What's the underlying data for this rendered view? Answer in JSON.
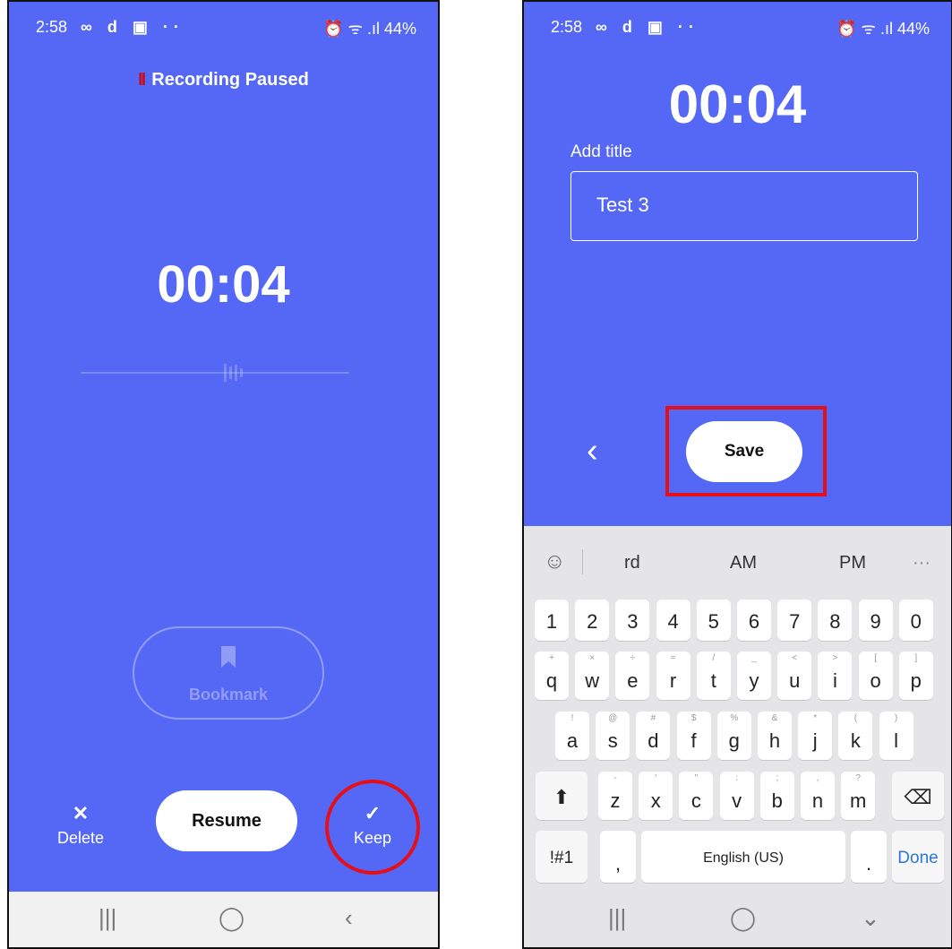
{
  "left": {
    "status": {
      "time": "2:58",
      "notif": "∞ d ▣ ··",
      "right": "⏰ ᯤ .ıl 44%"
    },
    "paused_icon": "II",
    "paused_label": "Recording Paused",
    "timer": "00:04",
    "bookmark_label": "Bookmark",
    "delete_icon": "✕",
    "delete_label": "Delete",
    "resume_label": "Resume",
    "keep_icon": "✓",
    "keep_label": "Keep",
    "nav": {
      "recents": "|||",
      "home": "◯",
      "back": "‹"
    }
  },
  "right": {
    "status": {
      "time": "2:58",
      "notif": "∞ d ▣ ··",
      "right": "⏰ ᯤ .ıl 44%"
    },
    "timer": "00:04",
    "add_title_label": "Add title",
    "title_value": "Test 3",
    "back_icon": "‹",
    "save_label": "Save",
    "suggestions": [
      "rd",
      "AM",
      "PM"
    ],
    "suggest_more": "···",
    "emoji_icon": "☺",
    "number_row": [
      "1",
      "2",
      "3",
      "4",
      "5",
      "6",
      "7",
      "8",
      "9",
      "0"
    ],
    "row_q": [
      [
        "q",
        "+"
      ],
      [
        "w",
        "×"
      ],
      [
        "e",
        "÷"
      ],
      [
        "r",
        "="
      ],
      [
        "t",
        "/"
      ],
      [
        "y",
        "_"
      ],
      [
        "u",
        "<"
      ],
      [
        "i",
        ">"
      ],
      [
        "o",
        "["
      ],
      [
        "p",
        "]"
      ]
    ],
    "row_a": [
      [
        "a",
        "!"
      ],
      [
        "s",
        "@"
      ],
      [
        "d",
        "#"
      ],
      [
        "f",
        "$"
      ],
      [
        "g",
        "%"
      ],
      [
        "h",
        "&"
      ],
      [
        "j",
        "*"
      ],
      [
        "k",
        "("
      ],
      [
        "l",
        ")"
      ]
    ],
    "row_z": [
      [
        "z",
        "-"
      ],
      [
        "x",
        "'"
      ],
      [
        "c",
        "\""
      ],
      [
        "v",
        ":"
      ],
      [
        "b",
        ";"
      ],
      [
        "n",
        ","
      ],
      [
        "m",
        "?"
      ]
    ],
    "shift": "⬆",
    "backspace": "⌫",
    "sym_key": "!#1",
    "comma_key": ",",
    "space_label": "English (US)",
    "period_key": ".",
    "done_label": "Done",
    "nav": {
      "recents": "|||",
      "home": "◯",
      "back": "⌄"
    }
  }
}
